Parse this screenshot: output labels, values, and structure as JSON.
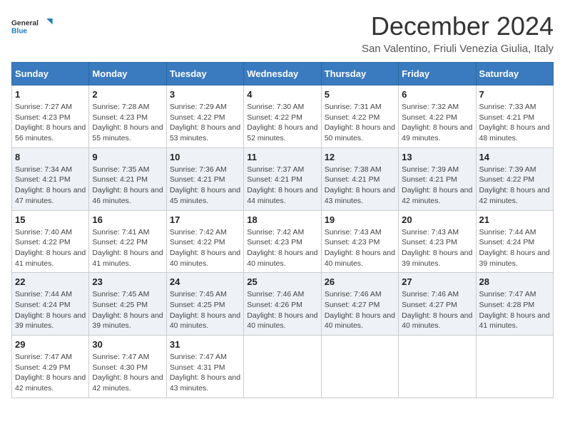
{
  "logo": {
    "line1": "General",
    "line2": "Blue"
  },
  "title": "December 2024",
  "subtitle": "San Valentino, Friuli Venezia Giulia, Italy",
  "days_of_week": [
    "Sunday",
    "Monday",
    "Tuesday",
    "Wednesday",
    "Thursday",
    "Friday",
    "Saturday"
  ],
  "weeks": [
    [
      {
        "day": "1",
        "sunrise": "7:27 AM",
        "sunset": "4:23 PM",
        "daylight": "8 hours and 56 minutes."
      },
      {
        "day": "2",
        "sunrise": "7:28 AM",
        "sunset": "4:23 PM",
        "daylight": "8 hours and 55 minutes."
      },
      {
        "day": "3",
        "sunrise": "7:29 AM",
        "sunset": "4:22 PM",
        "daylight": "8 hours and 53 minutes."
      },
      {
        "day": "4",
        "sunrise": "7:30 AM",
        "sunset": "4:22 PM",
        "daylight": "8 hours and 52 minutes."
      },
      {
        "day": "5",
        "sunrise": "7:31 AM",
        "sunset": "4:22 PM",
        "daylight": "8 hours and 50 minutes."
      },
      {
        "day": "6",
        "sunrise": "7:32 AM",
        "sunset": "4:22 PM",
        "daylight": "8 hours and 49 minutes."
      },
      {
        "day": "7",
        "sunrise": "7:33 AM",
        "sunset": "4:21 PM",
        "daylight": "8 hours and 48 minutes."
      }
    ],
    [
      {
        "day": "8",
        "sunrise": "7:34 AM",
        "sunset": "4:21 PM",
        "daylight": "8 hours and 47 minutes."
      },
      {
        "day": "9",
        "sunrise": "7:35 AM",
        "sunset": "4:21 PM",
        "daylight": "8 hours and 46 minutes."
      },
      {
        "day": "10",
        "sunrise": "7:36 AM",
        "sunset": "4:21 PM",
        "daylight": "8 hours and 45 minutes."
      },
      {
        "day": "11",
        "sunrise": "7:37 AM",
        "sunset": "4:21 PM",
        "daylight": "8 hours and 44 minutes."
      },
      {
        "day": "12",
        "sunrise": "7:38 AM",
        "sunset": "4:21 PM",
        "daylight": "8 hours and 43 minutes."
      },
      {
        "day": "13",
        "sunrise": "7:39 AM",
        "sunset": "4:21 PM",
        "daylight": "8 hours and 42 minutes."
      },
      {
        "day": "14",
        "sunrise": "7:39 AM",
        "sunset": "4:22 PM",
        "daylight": "8 hours and 42 minutes."
      }
    ],
    [
      {
        "day": "15",
        "sunrise": "7:40 AM",
        "sunset": "4:22 PM",
        "daylight": "8 hours and 41 minutes."
      },
      {
        "day": "16",
        "sunrise": "7:41 AM",
        "sunset": "4:22 PM",
        "daylight": "8 hours and 41 minutes."
      },
      {
        "day": "17",
        "sunrise": "7:42 AM",
        "sunset": "4:22 PM",
        "daylight": "8 hours and 40 minutes."
      },
      {
        "day": "18",
        "sunrise": "7:42 AM",
        "sunset": "4:23 PM",
        "daylight": "8 hours and 40 minutes."
      },
      {
        "day": "19",
        "sunrise": "7:43 AM",
        "sunset": "4:23 PM",
        "daylight": "8 hours and 40 minutes."
      },
      {
        "day": "20",
        "sunrise": "7:43 AM",
        "sunset": "4:23 PM",
        "daylight": "8 hours and 39 minutes."
      },
      {
        "day": "21",
        "sunrise": "7:44 AM",
        "sunset": "4:24 PM",
        "daylight": "8 hours and 39 minutes."
      }
    ],
    [
      {
        "day": "22",
        "sunrise": "7:44 AM",
        "sunset": "4:24 PM",
        "daylight": "8 hours and 39 minutes."
      },
      {
        "day": "23",
        "sunrise": "7:45 AM",
        "sunset": "4:25 PM",
        "daylight": "8 hours and 39 minutes."
      },
      {
        "day": "24",
        "sunrise": "7:45 AM",
        "sunset": "4:25 PM",
        "daylight": "8 hours and 40 minutes."
      },
      {
        "day": "25",
        "sunrise": "7:46 AM",
        "sunset": "4:26 PM",
        "daylight": "8 hours and 40 minutes."
      },
      {
        "day": "26",
        "sunrise": "7:46 AM",
        "sunset": "4:27 PM",
        "daylight": "8 hours and 40 minutes."
      },
      {
        "day": "27",
        "sunrise": "7:46 AM",
        "sunset": "4:27 PM",
        "daylight": "8 hours and 40 minutes."
      },
      {
        "day": "28",
        "sunrise": "7:47 AM",
        "sunset": "4:28 PM",
        "daylight": "8 hours and 41 minutes."
      }
    ],
    [
      {
        "day": "29",
        "sunrise": "7:47 AM",
        "sunset": "4:29 PM",
        "daylight": "8 hours and 42 minutes."
      },
      {
        "day": "30",
        "sunrise": "7:47 AM",
        "sunset": "4:30 PM",
        "daylight": "8 hours and 42 minutes."
      },
      {
        "day": "31",
        "sunrise": "7:47 AM",
        "sunset": "4:31 PM",
        "daylight": "8 hours and 43 minutes."
      },
      null,
      null,
      null,
      null
    ]
  ]
}
